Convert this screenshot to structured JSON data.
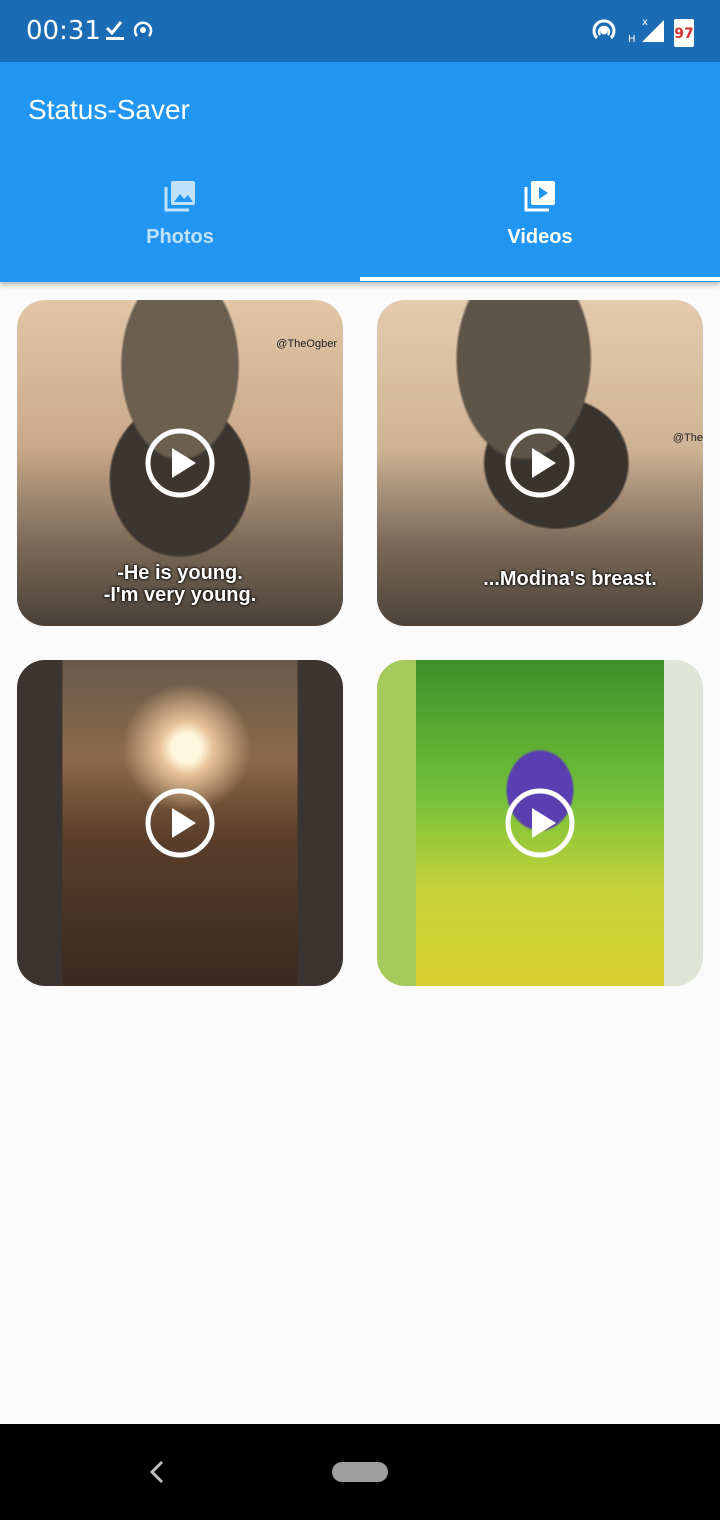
{
  "status_bar": {
    "time": "00:31",
    "battery": "97",
    "left_icons": [
      "download-done-icon",
      "hotspot-icon"
    ],
    "right_icons": [
      "hotspot-icon",
      "signal-icon",
      "battery-icon"
    ]
  },
  "app": {
    "title": "Status-Saver",
    "accent_color": "#2196f3",
    "status_bar_color": "#1a6db5"
  },
  "tabs": [
    {
      "label": "Photos",
      "icon": "photo-library-icon",
      "selected": false
    },
    {
      "label": "Videos",
      "icon": "video-library-icon",
      "selected": true
    }
  ],
  "videos": [
    {
      "caption": "-He is young.\n-I'm very young.",
      "watermark": "@TheOgber",
      "icon": "play-icon"
    },
    {
      "caption": "...Modina's breast.",
      "watermark": "@The",
      "icon": "play-icon"
    },
    {
      "caption": "",
      "watermark": "",
      "icon": "play-icon"
    },
    {
      "caption": "",
      "watermark": "",
      "icon": "play-icon"
    }
  ],
  "nav_bar": {
    "icons": [
      "back-icon",
      "home-pill-icon"
    ]
  }
}
